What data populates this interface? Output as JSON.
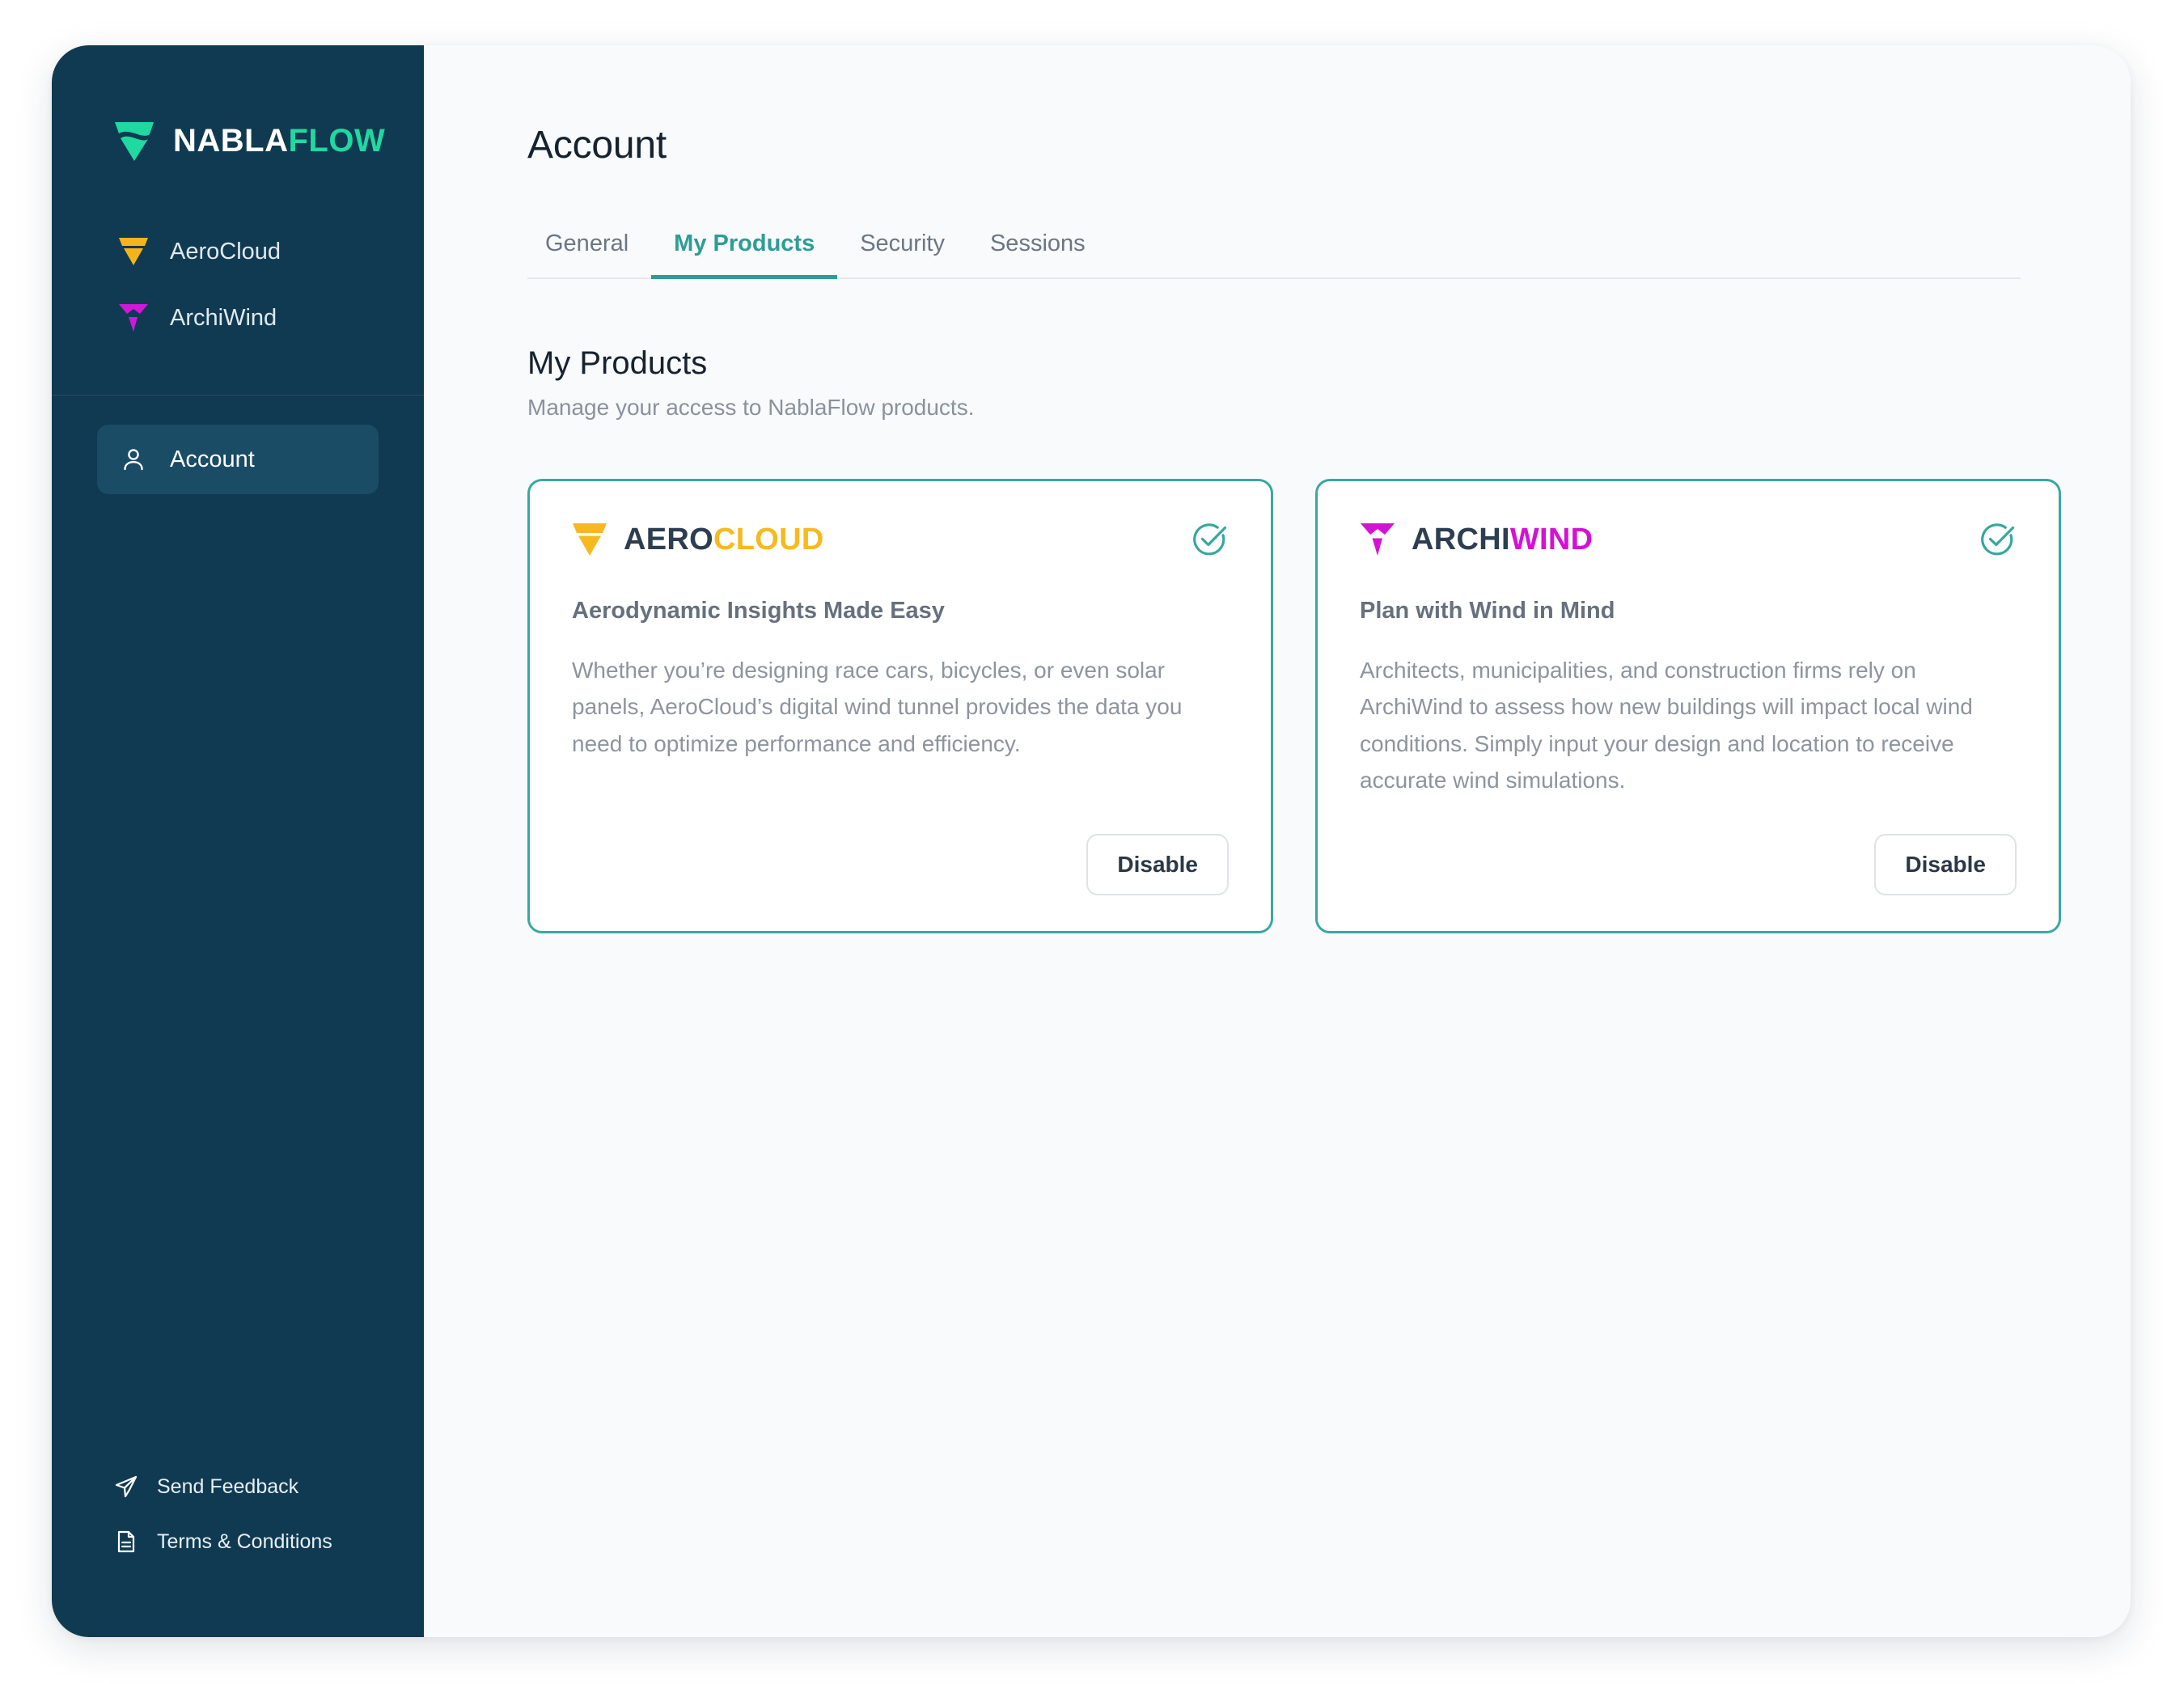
{
  "brand": {
    "name_part1": "NABLA",
    "name_part2": "FLOW",
    "mark": "nabla-logo-icon",
    "color_primary": "#1fd9a0",
    "color_sidebar_bg": "#103a51"
  },
  "sidebar": {
    "products": [
      {
        "label": "AeroCloud",
        "icon": "aerocloud-nabla-icon",
        "color": "#f5b51a"
      },
      {
        "label": "ArchiWind",
        "icon": "archiwind-nabla-icon",
        "color": "#cf19d8"
      }
    ],
    "account_item": {
      "label": "Account",
      "icon": "user-icon",
      "active": true
    },
    "footer": [
      {
        "label": "Send Feedback",
        "icon": "send-paper-plane-icon"
      },
      {
        "label": "Terms & Conditions",
        "icon": "document-icon"
      }
    ]
  },
  "header": {
    "title": "Account"
  },
  "tabs": [
    {
      "label": "General",
      "active": false
    },
    {
      "label": "My Products",
      "active": true
    },
    {
      "label": "Security",
      "active": false
    },
    {
      "label": "Sessions",
      "active": false
    }
  ],
  "section": {
    "title": "My Products",
    "subtitle": "Manage your access to NablaFlow products."
  },
  "products": [
    {
      "logo_part1": "AERO",
      "logo_part2": "CLOUD",
      "logo_color": "#f6ba20",
      "mark": "aerocloud-nabla-icon",
      "status_icon": "check-circle-icon",
      "status_color": "#35a79f",
      "heading": "Aerodynamic Insights Made Easy",
      "description": "Whether you’re designing race cars, bicycles, or even solar panels, AeroCloud’s digital wind tunnel provides the data you need to optimize performance and efficiency.",
      "action_label": "Disable"
    },
    {
      "logo_part1": "ARCHI",
      "logo_part2": "WIND",
      "logo_color": "#d412d4",
      "mark": "archiwind-nabla-icon",
      "status_icon": "check-circle-icon",
      "status_color": "#35a79f",
      "heading": "Plan with Wind in Mind",
      "description": "Architects, municipalities, and construction firms rely on ArchiWind to assess how new buildings will impact local wind conditions. Simply input your design and location to receive accurate wind simulations.",
      "action_label": "Disable"
    }
  ]
}
